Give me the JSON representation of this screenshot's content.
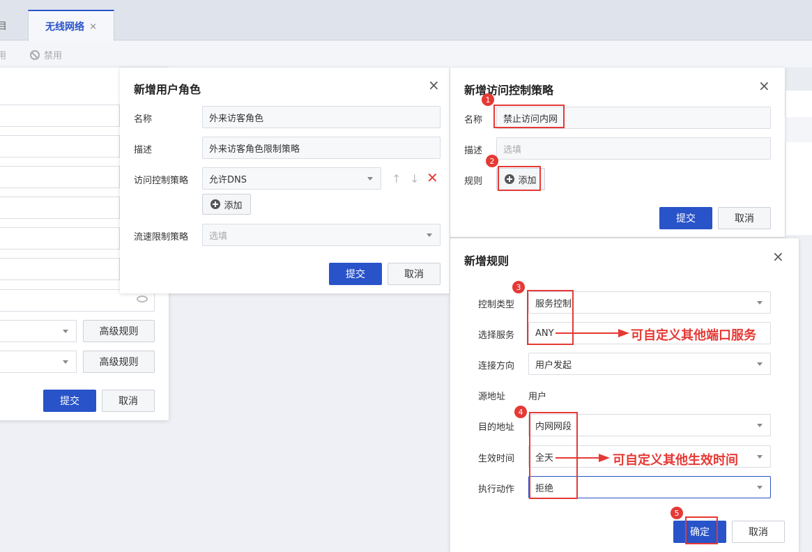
{
  "tabs": {
    "tab1": "目",
    "tab2": "无线网络",
    "tab2_close": "×"
  },
  "toolbar": {
    "enable": "用",
    "disable": "禁用"
  },
  "bg": {
    "advanced1": "高级规则",
    "advanced2": "高级规则",
    "submit": "提交",
    "cancel": "取消"
  },
  "role": {
    "title": "新增用户角色",
    "close": "×",
    "name_label": "名称",
    "name_value": "外来访客角色",
    "desc_label": "描述",
    "desc_value": "外来访客角色限制策略",
    "acl_label": "访问控制策略",
    "acl_value": "允许DNS",
    "add": "添加",
    "rate_label": "流速限制策略",
    "rate_placeholder": "选填",
    "submit": "提交",
    "cancel": "取消"
  },
  "acl": {
    "title": "新增访问控制策略",
    "close": "×",
    "name_label": "名称",
    "name_value": "禁止访问内网",
    "desc_label": "描述",
    "desc_placeholder": "选填",
    "rule_label": "规则",
    "add": "添加",
    "submit": "提交",
    "cancel": "取消"
  },
  "rule": {
    "title": "新增规则",
    "close": "×",
    "type_label": "控制类型",
    "type_value": "服务控制",
    "service_label": "选择服务",
    "service_value": "ANY",
    "direction_label": "连接方向",
    "direction_value": "用户发起",
    "src_label": "源地址",
    "src_value": "用户",
    "dst_label": "目的地址",
    "dst_value": "内网网段",
    "time_label": "生效时间",
    "time_value": "全天",
    "action_label": "执行动作",
    "action_value": "拒绝",
    "ok": "确定",
    "cancel": "取消"
  },
  "annotations": {
    "b1": "1",
    "b2": "2",
    "b3": "3",
    "b4": "4",
    "b5": "5",
    "note_service": "可自定义其他端口服务",
    "note_time": "可自定义其他生效时间"
  },
  "colors": {
    "primary": "#2953c9",
    "annotation": "#e53935",
    "delete": "#e53935"
  }
}
